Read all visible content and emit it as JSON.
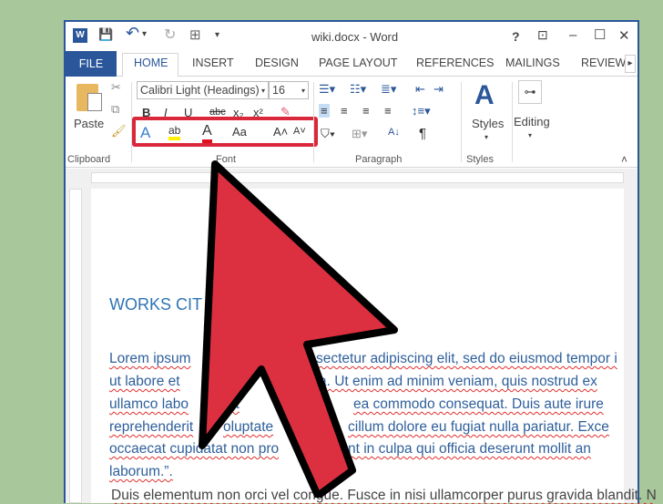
{
  "window": {
    "title": "wiki.docx - Word",
    "help": "?",
    "ribbon_display": "⊡",
    "minimize": "–",
    "maximize": "☐",
    "close": "✕"
  },
  "qat": {
    "word_icon": "W",
    "save": "💾",
    "undo": "↶",
    "undo_menu": "▾",
    "redo": "↻",
    "touch": "⊞",
    "customize": "▾"
  },
  "tabs": [
    "FILE",
    "HOME",
    "INSERT",
    "DESIGN",
    "PAGE LAYOUT",
    "REFERENCES",
    "MAILINGS",
    "REVIEW"
  ],
  "tabs_scroll": "▸",
  "ribbon": {
    "clipboard": {
      "paste": "Paste",
      "label": "Clipboard"
    },
    "font": {
      "name": "Calibri Light (Headings)",
      "size": "16",
      "bold": "B",
      "italic": "I",
      "underline": "U",
      "strike": "abc",
      "sub": "x₂",
      "sup": "x²",
      "effects": "A",
      "highlight": "ab",
      "color": "A",
      "case": "Aa",
      "grow": "A˄",
      "shrink": "A˅",
      "label": "Font"
    },
    "paragraph": {
      "label": "Paragraph",
      "pilcrow": "¶",
      "sort": "A↓"
    },
    "styles": {
      "button": "Styles",
      "label": "Styles"
    },
    "editing": {
      "button": "Editing"
    },
    "collapse": "˄"
  },
  "highlight_color": "#d9283b",
  "document": {
    "heading": "WORKS CIT",
    "lines": [
      [
        "Lorem ipsum",
        "sectetur adipiscing elit, sed do eiusmod tempor i"
      ],
      [
        "ut labore et",
        "a. Ut enim ad minim veniam, quis nostrud ex"
      ],
      [
        "ullamco labo",
        "ut",
        "ea commodo consequat. Duis aute irure"
      ],
      [
        "reprehenderit",
        "oluptate",
        "cillum dolore eu fugiat nulla pariatur. Exce"
      ],
      [
        "occaecat cupidatat non pro",
        "nt in culpa qui officia deserunt mollit an"
      ],
      [
        "laborum.”."
      ],
      [
        "Duis elementum non orci vel congue. Fusce in nisi ullamcorper purus gravida blandit. N"
      ]
    ]
  }
}
